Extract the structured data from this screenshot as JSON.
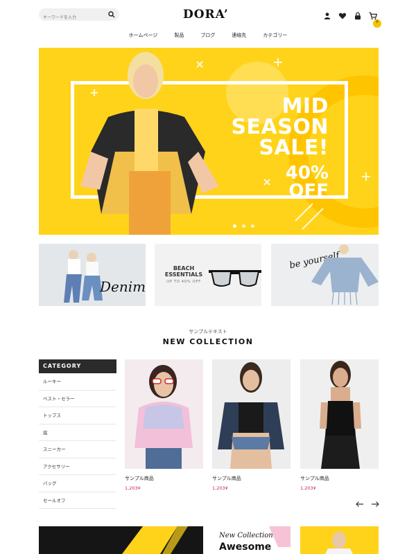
{
  "header": {
    "search_placeholder": "キーワードを入力",
    "logo": "DORA’",
    "cart_count": "0",
    "icons": [
      "user-icon",
      "heart-icon",
      "lock-icon",
      "cart-icon"
    ]
  },
  "nav": [
    "ホームページ",
    "製品",
    "ブログ",
    "連絡先",
    "カテゴリー"
  ],
  "hero": {
    "line1": "MID",
    "line2": "SEASON",
    "line3": "SALE!",
    "line4": "40%",
    "line5": "OFF",
    "slides": 3,
    "active_slide": 1
  },
  "banners": {
    "denim": "Denim",
    "beach_title": "BEACH ESSENTIALS",
    "beach_sub": "UP TO 40% OFF",
    "beyourself": "be yourself"
  },
  "collection": {
    "kicker": "サンプルテキスト",
    "title": "NEW COLLECTION"
  },
  "category": {
    "title": "CATEGORY",
    "items": [
      "ルーキー",
      "ベスト・セラー",
      "トップス",
      "底",
      "スニーカー",
      "アクセサリー",
      "バッグ",
      "セールオフ"
    ]
  },
  "products": [
    {
      "name": "サンプル商品",
      "price": "1,203¥"
    },
    {
      "name": "サンプル商品",
      "price": "1,203¥"
    },
    {
      "name": "サンプル商品",
      "price": "1,203¥"
    }
  ],
  "bottom": {
    "new_collection": "New Collection",
    "awesome": "Awesome"
  },
  "colors": {
    "accent_yellow": "#ffd31a",
    "price_red": "#c0264b",
    "category_header": "#2b2b2b"
  }
}
